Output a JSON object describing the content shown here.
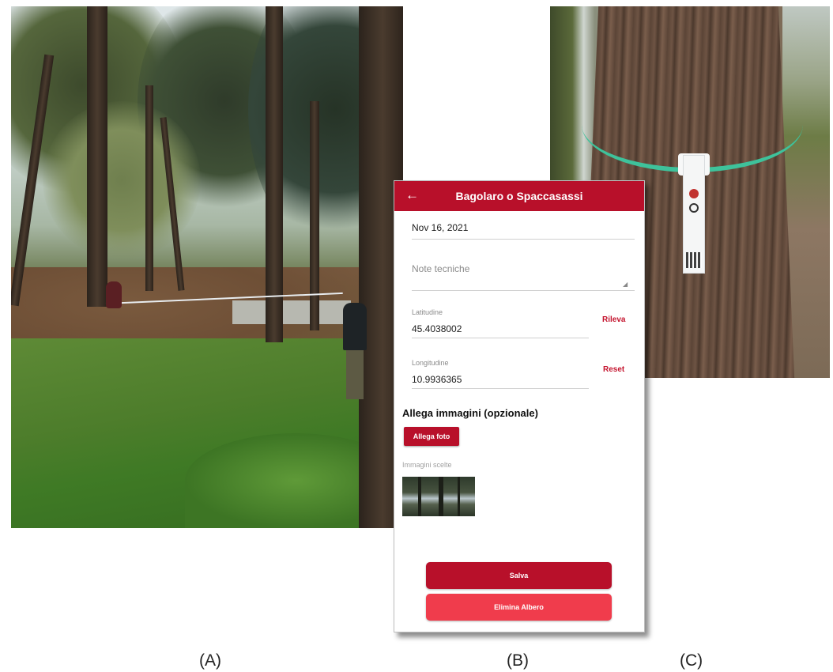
{
  "captions": {
    "a": "(A)",
    "b": "(B)",
    "c": "(C)"
  },
  "app": {
    "title": "Bagolaro o Spaccasassi",
    "back_icon": "arrow-left-icon",
    "date_value": "Nov 16, 2021",
    "notes_label": "Note tecniche",
    "latitude_label": "Latitudine",
    "latitude_value": "45.4038002",
    "detect_label": "Rileva",
    "longitude_label": "Longitudine",
    "longitude_value": "10.9936365",
    "reset_label": "Reset",
    "attach_heading": "Allega immagini (opzionale)",
    "attach_button": "Allega foto",
    "chosen_images_label": "Immagini scelte",
    "save_button": "Salva",
    "delete_button": "Elimina Albero",
    "colors": {
      "primary": "#b8102a",
      "danger": "#f03c4c"
    }
  },
  "photos": {
    "a": "park-trees-measurement-photo",
    "c": "tree-trunk-tag-photo"
  }
}
